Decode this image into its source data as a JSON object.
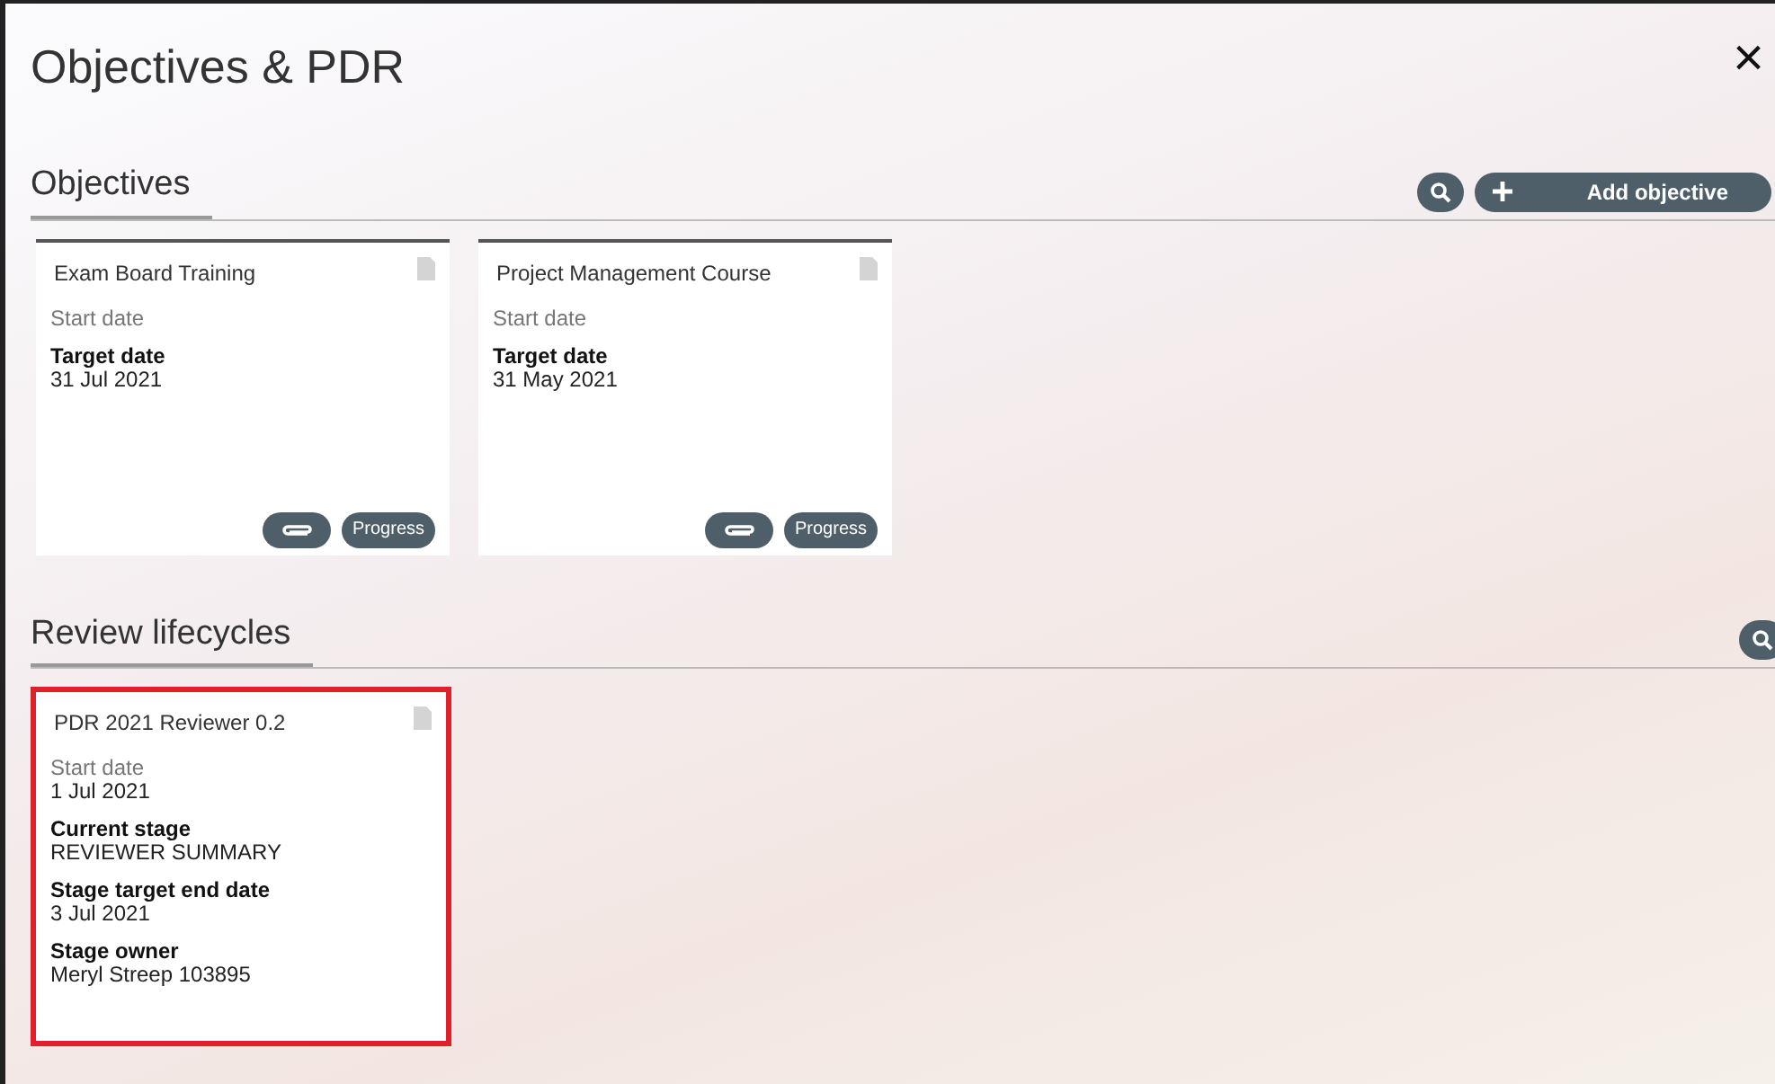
{
  "window": {
    "title": "Objectives & PDR",
    "close": "×"
  },
  "objectives": {
    "heading": "Objectives",
    "add_button": "Add objective",
    "cards": [
      {
        "title": "Exam Board Training",
        "highlighted": false,
        "fields": [
          {
            "label": "Start date",
            "muted": true
          },
          {
            "label": "Target date",
            "value": "31 Jul 2021",
            "muted": false
          }
        ],
        "progress_button": "Progress"
      },
      {
        "title": "Project Management Course",
        "highlighted": false,
        "fields": [
          {
            "label": "Start date",
            "muted": true
          },
          {
            "label": "Target date",
            "value": "31 May 2021",
            "muted": false
          }
        ],
        "progress_button": "Progress"
      }
    ]
  },
  "review_lifecycles": {
    "heading": "Review lifecycles",
    "cards": [
      {
        "title": "PDR 2021 Reviewer 0.2",
        "highlighted": true,
        "fields": [
          {
            "label": "Start date",
            "value": "1 Jul 2021",
            "muted": true
          },
          {
            "label": "Current stage",
            "value": "REVIEWER SUMMARY",
            "muted": false
          },
          {
            "label": "Stage target end date",
            "value": "3 Jul 2021",
            "muted": false
          },
          {
            "label": "Stage owner",
            "value": "Meryl Streep 103895",
            "muted": false
          }
        ]
      }
    ]
  }
}
